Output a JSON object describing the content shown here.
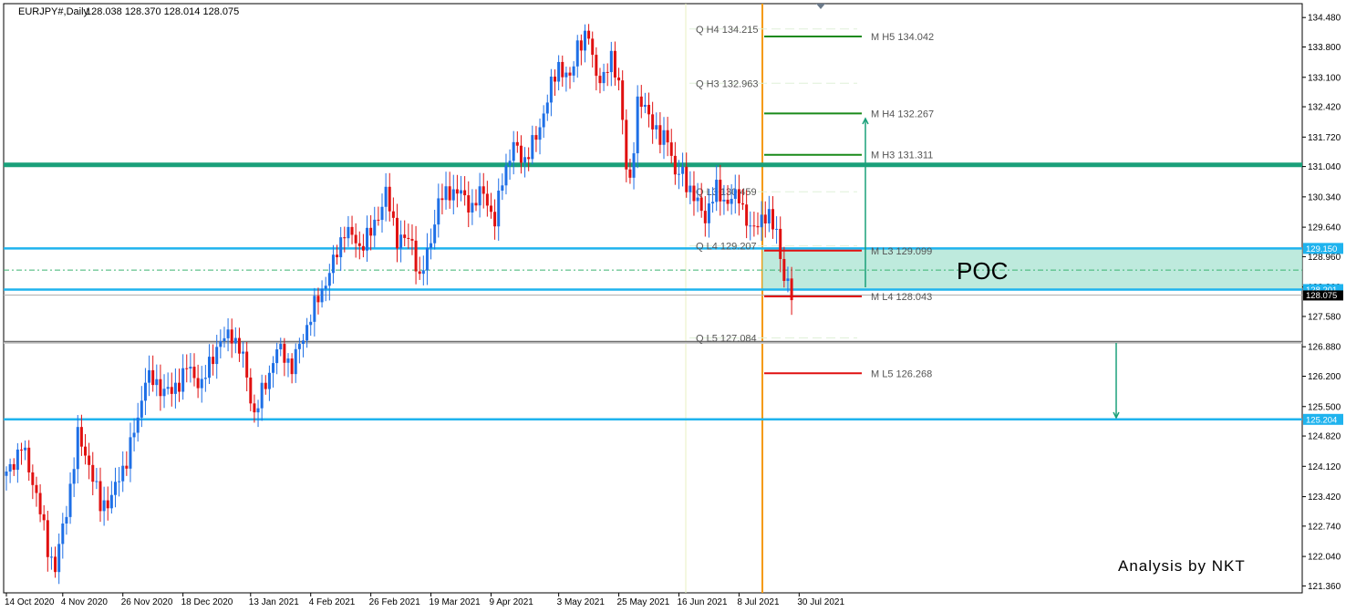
{
  "header": {
    "symbol": "EURJPY#,Daily",
    "ohlc": "128.038 128.370 128.014 128.075"
  },
  "chart_data": {
    "type": "candlestick",
    "ylim": [
      121.2,
      134.8
    ],
    "y_ticks": [
      "134.480",
      "133.800",
      "133.100",
      "132.420",
      "131.720",
      "131.040",
      "130.340",
      "129.640",
      "128.960",
      "128.260",
      "127.580",
      "126.880",
      "126.200",
      "125.500",
      "124.820",
      "124.120",
      "123.420",
      "122.740",
      "122.040",
      "121.360"
    ],
    "x_ticks": [
      "14 Oct 2020",
      "4 Nov 2020",
      "26 Nov 2020",
      "18 Dec 2020",
      "13 Jan 2021",
      "4 Feb 2021",
      "26 Feb 2021",
      "19 Mar 2021",
      "9 Apr 2021",
      "3 May 2021",
      "25 May 2021",
      "16 Jun 2021",
      "8 Jul 2021",
      "30 Jul 2021"
    ],
    "x_tick_bar_index": [
      0,
      15,
      31,
      47,
      65,
      81,
      97,
      113,
      129,
      147,
      163,
      179,
      195,
      211
    ],
    "last_price": "128.075",
    "colors": {
      "up": "#1e6fe6",
      "down": "#e01010"
    },
    "anchors": [
      [
        0,
        123.9
      ],
      [
        4,
        124.6
      ],
      [
        8,
        123.5
      ],
      [
        11,
        122.2
      ],
      [
        13,
        121.8
      ],
      [
        16,
        123.1
      ],
      [
        19,
        124.8
      ],
      [
        22,
        124.2
      ],
      [
        25,
        123.2
      ],
      [
        28,
        123.4
      ],
      [
        32,
        124.3
      ],
      [
        35,
        125.2
      ],
      [
        37,
        126.2
      ],
      [
        40,
        126.0
      ],
      [
        44,
        125.8
      ],
      [
        48,
        126.4
      ],
      [
        52,
        126.0
      ],
      [
        56,
        126.9
      ],
      [
        60,
        127.2
      ],
      [
        63,
        126.6
      ],
      [
        66,
        125.3
      ],
      [
        68,
        125.8
      ],
      [
        70,
        126.3
      ],
      [
        72,
        126.8
      ],
      [
        74,
        126.7
      ],
      [
        76,
        126.4
      ],
      [
        78,
        126.9
      ],
      [
        81,
        127.6
      ],
      [
        84,
        128.2
      ],
      [
        87,
        128.8
      ],
      [
        90,
        129.6
      ],
      [
        94,
        129.2
      ],
      [
        97,
        129.5
      ],
      [
        101,
        130.4
      ],
      [
        104,
        129.4
      ],
      [
        108,
        129.3
      ],
      [
        110,
        128.4
      ],
      [
        112,
        129.0
      ],
      [
        115,
        130.2
      ],
      [
        118,
        130.5
      ],
      [
        121,
        130.4
      ],
      [
        124,
        130.1
      ],
      [
        127,
        130.5
      ],
      [
        130,
        129.7
      ],
      [
        132,
        130.8
      ],
      [
        135,
        131.5
      ],
      [
        138,
        131.2
      ],
      [
        141,
        131.7
      ],
      [
        144,
        132.6
      ],
      [
        147,
        133.4
      ],
      [
        150,
        133.0
      ],
      [
        152,
        133.9
      ],
      [
        155,
        134.0
      ],
      [
        157,
        133.2
      ],
      [
        159,
        133.0
      ],
      [
        161,
        133.6
      ],
      [
        163,
        133.0
      ],
      [
        165,
        131.0
      ],
      [
        166,
        130.7
      ],
      [
        168,
        132.5
      ],
      [
        171,
        132.3
      ],
      [
        174,
        131.6
      ],
      [
        176,
        131.8
      ],
      [
        178,
        130.8
      ],
      [
        180,
        130.9
      ],
      [
        183,
        130.3
      ],
      [
        186,
        129.9
      ],
      [
        189,
        130.5
      ],
      [
        192,
        130.2
      ],
      [
        195,
        130.4
      ],
      [
        198,
        129.5
      ],
      [
        201,
        129.9
      ],
      [
        203,
        129.8
      ],
      [
        205,
        129.6
      ],
      [
        207,
        128.4
      ],
      [
        209,
        128.1
      ]
    ],
    "levels": [
      {
        "name": "Q H4",
        "label": "Q   H4 134.215",
        "value": 134.215,
        "style": "q"
      },
      {
        "name": "Q H3",
        "label": "Q   H3 132.963",
        "value": 132.963,
        "style": "q"
      },
      {
        "name": "Q L3",
        "label": "Q   L3 130.459",
        "value": 130.459,
        "style": "q"
      },
      {
        "name": "Q L4",
        "label": "Q   L4 129.207",
        "value": 129.207,
        "style": "q"
      },
      {
        "name": "Q L5",
        "label": "Q   L5 127.084",
        "value": 127.084,
        "style": "q"
      },
      {
        "name": "M H5",
        "label": "M   H5 134.042",
        "value": 134.042,
        "style": "green"
      },
      {
        "name": "M H4",
        "label": "M   H4 132.267",
        "value": 132.267,
        "style": "green"
      },
      {
        "name": "M H3",
        "label": "M   H3 131.311",
        "value": 131.311,
        "style": "green"
      },
      {
        "name": "M L3",
        "label": "M   L3 129.099",
        "value": 129.099,
        "style": "red"
      },
      {
        "name": "M L4",
        "label": "M   L4 128.043",
        "value": 128.043,
        "style": "red"
      },
      {
        "name": "M L5",
        "label": "M   L5 126.268",
        "value": 126.268,
        "style": "red"
      }
    ],
    "horizontal_lines": [
      {
        "value": 131.08,
        "color": "#1aa07a",
        "label": ""
      },
      {
        "value": 129.15,
        "color": "#1fb3ee",
        "label": "129.150"
      },
      {
        "value": 128.201,
        "color": "#1fb3ee",
        "label": "128.201"
      },
      {
        "value": 127.0,
        "color": "#999999",
        "label": ""
      },
      {
        "value": 125.204,
        "color": "#1fb3ee",
        "label": "125.204"
      }
    ],
    "poc_zone": {
      "from": 128.201,
      "to": 129.15,
      "label": "POC",
      "color": "#a8e3d2"
    },
    "annotations": {
      "credit": "Analysis by NKT"
    }
  }
}
